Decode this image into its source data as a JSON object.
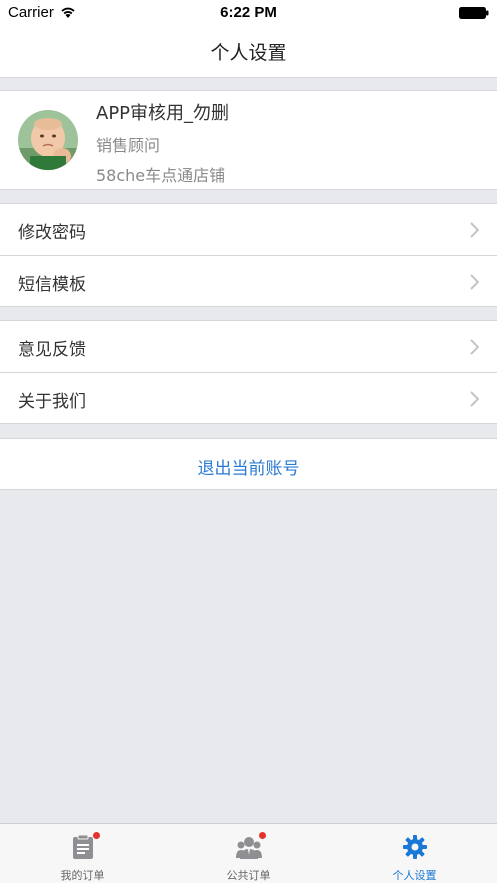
{
  "status_bar": {
    "carrier": "Carrier",
    "time": "6:22 PM"
  },
  "nav": {
    "title": "个人设置"
  },
  "profile": {
    "name": "APP审核用_勿删",
    "role": "销售顾问",
    "shop": "58che车点通店铺"
  },
  "menu": {
    "group1": [
      {
        "label": "修改密码"
      },
      {
        "label": "短信模板"
      }
    ],
    "group2": [
      {
        "label": "意见反馈"
      },
      {
        "label": "关于我们"
      }
    ]
  },
  "logout": {
    "label": "退出当前账号"
  },
  "tab_bar": {
    "tabs": [
      {
        "label": "我的订单",
        "icon": "clipboard-icon",
        "badge": true
      },
      {
        "label": "公共订单",
        "icon": "people-icon",
        "badge": true
      },
      {
        "label": "个人设置",
        "icon": "gear-icon",
        "active": true
      }
    ]
  },
  "colors": {
    "accent": "#1a78d6",
    "badge": "#e5322d",
    "background": "#e8e9ec"
  }
}
